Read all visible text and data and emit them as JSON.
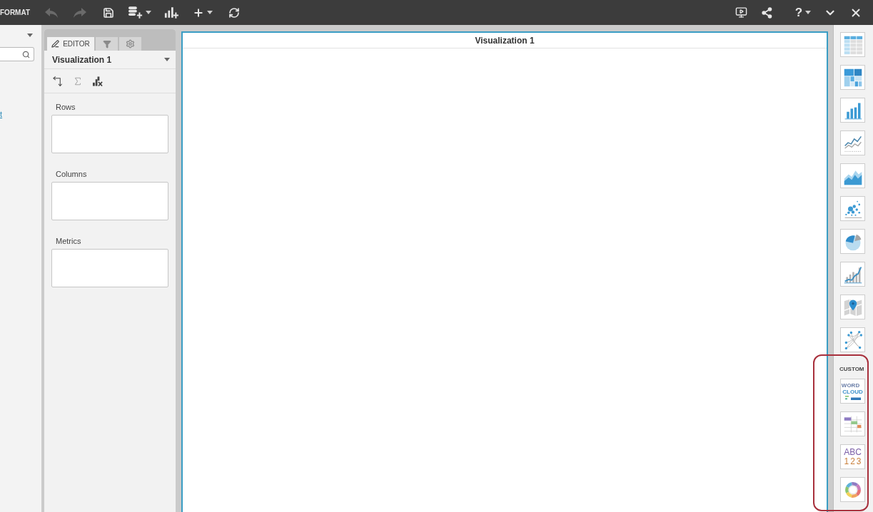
{
  "toolbar": {
    "title": "FORMAT",
    "left_buttons": [
      {
        "kind": "undo",
        "disabled": true,
        "menu": false
      },
      {
        "kind": "redo",
        "disabled": true,
        "menu": false
      },
      {
        "kind": "save",
        "disabled": false,
        "menu": false
      },
      {
        "kind": "add_data",
        "disabled": false,
        "menu": true
      },
      {
        "kind": "add_chart",
        "disabled": false,
        "menu": false
      },
      {
        "kind": "add",
        "disabled": false,
        "menu": true
      },
      {
        "kind": "refresh",
        "disabled": false,
        "menu": false
      }
    ],
    "right_buttons": [
      {
        "kind": "present",
        "menu": false
      },
      {
        "kind": "share",
        "menu": false
      },
      {
        "kind": "help",
        "label": "?",
        "menu": true
      },
      {
        "kind": "collapse",
        "menu": false
      },
      {
        "kind": "close",
        "menu": false
      }
    ]
  },
  "data_panel": {
    "link": "t"
  },
  "editor": {
    "tabs": [
      {
        "kind": "editor",
        "label": "EDITOR",
        "selected": true
      },
      {
        "kind": "filter",
        "selected": false
      },
      {
        "kind": "settings",
        "selected": false
      }
    ],
    "visualization": "Visualization 1",
    "tools": [
      {
        "kind": "swap",
        "disabled": false
      },
      {
        "kind": "sum",
        "disabled": true
      },
      {
        "kind": "clear",
        "disabled": false
      }
    ],
    "drop_zones": [
      {
        "label": "Rows"
      },
      {
        "label": "Columns"
      },
      {
        "label": "Metrics"
      }
    ]
  },
  "canvas": {
    "title": "Visualization 1"
  },
  "gallery": {
    "builtin": [
      {
        "kind": "table"
      },
      {
        "kind": "treemap"
      },
      {
        "kind": "bar"
      },
      {
        "kind": "line"
      },
      {
        "kind": "area"
      },
      {
        "kind": "scatter"
      },
      {
        "kind": "pie"
      },
      {
        "kind": "combo"
      },
      {
        "kind": "map"
      },
      {
        "kind": "network"
      }
    ],
    "custom_label": "CUSTOM",
    "custom": [
      {
        "kind": "word_cloud",
        "lines": [
          "WORD",
          "CLOUD"
        ]
      },
      {
        "kind": "gantt"
      },
      {
        "kind": "text",
        "lines": [
          "ABC",
          "123"
        ]
      },
      {
        "kind": "ring"
      }
    ]
  }
}
